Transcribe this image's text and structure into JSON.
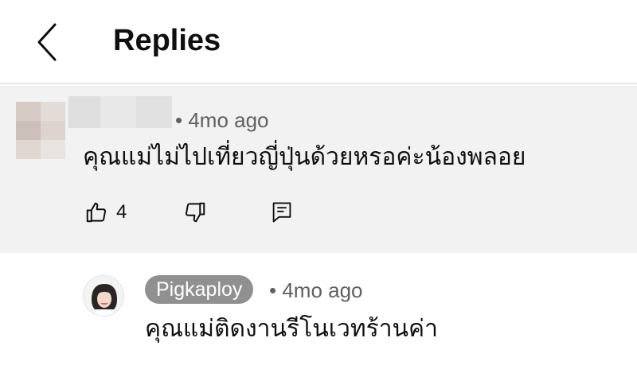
{
  "header": {
    "title": "Replies"
  },
  "parent_comment": {
    "time": "• 4mo ago",
    "text": "คุณแม่ไม่ไปเที่ยวญี่ปุ่นด้วยหรอค่ะน้องพลอย",
    "like_count": "4"
  },
  "reply": {
    "author": "Pigkaploy",
    "time": "• 4mo ago",
    "text": "คุณแม่ติดงานรีโนเวทร้านค่า"
  },
  "icons": {
    "back": "chevron-left-icon",
    "like": "thumbs-up-icon",
    "dislike": "thumbs-down-icon",
    "reply": "comment-icon"
  },
  "colors": {
    "parent_background": "#f2f2f2",
    "author_badge": "#909090",
    "meta_text": "#606060"
  }
}
